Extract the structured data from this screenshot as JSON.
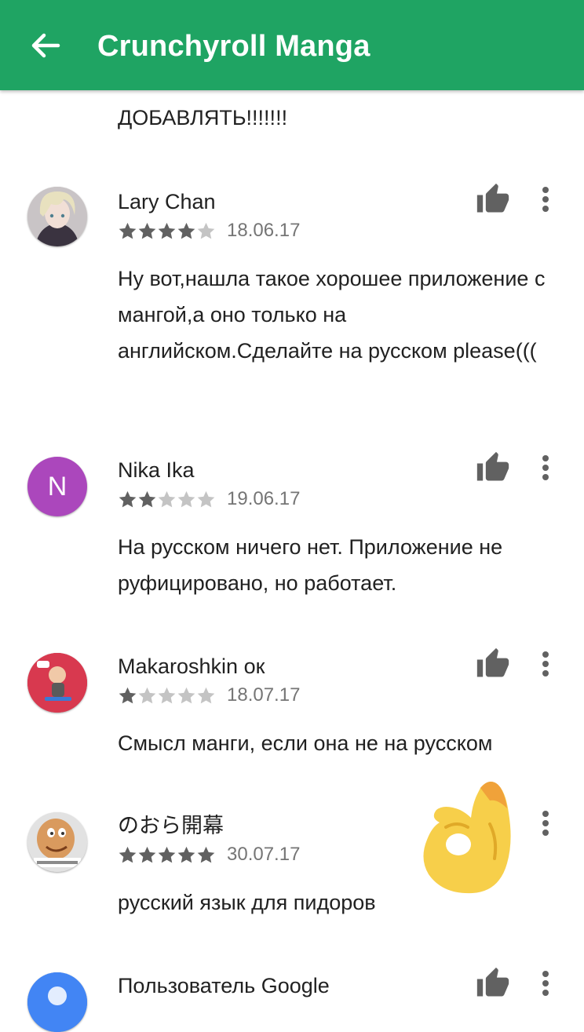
{
  "app_bar": {
    "title": "Crunchyroll Manga",
    "back_icon": "arrow-back-icon"
  },
  "partial_review": {
    "text_tail": "ДОБАВЛЯТЬ!!!!!!!"
  },
  "colors": {
    "app_bar": "#1fa463",
    "star_filled": "#616161",
    "star_empty": "#c4c4c4",
    "avatar_nika": "#ab47bc",
    "avatar_google": "#4285f4"
  },
  "reviews": [
    {
      "author": "Lary Chan",
      "rating": 4,
      "date": "18.06.17",
      "text": "Ну вот,нашла такое хорошее приложение с мангой,а оно только на английском.Сделайте на русском please((("
    },
    {
      "author": "Nika Ika",
      "avatar_letter": "N",
      "rating": 2,
      "date": "19.06.17",
      "text": "На русском ничего нет. Приложение не руфицировано, но работает."
    },
    {
      "author": "Makaroshkin ок",
      "rating": 1,
      "date": "18.07.17",
      "text": "Смысл манги, если она не на русском"
    },
    {
      "author": "のおら開幕",
      "rating": 5,
      "date": "30.07.17",
      "text": "русский язык для пидоров"
    },
    {
      "author": "Пользователь Google"
    }
  ],
  "icons": {
    "like": "thumb-up-icon",
    "more": "more-vert-icon",
    "sticker": "ok-hand-emoji"
  }
}
